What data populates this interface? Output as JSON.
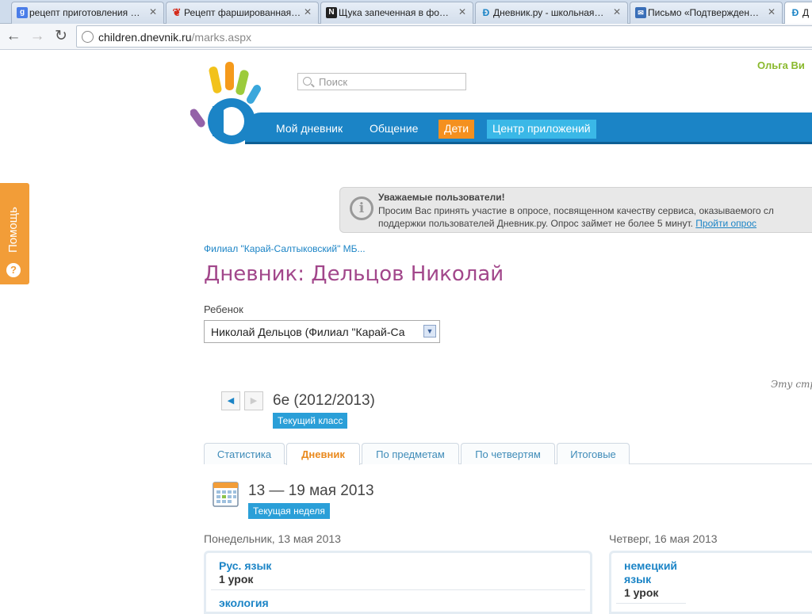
{
  "browser": {
    "tabs": [
      {
        "title": "рецепт приготовления …",
        "icon": "google-icon"
      },
      {
        "title": "Рецепт фаршированная…",
        "icon": "chili-icon"
      },
      {
        "title": "Щука запеченная в фо…",
        "icon": "n-logo-icon"
      },
      {
        "title": "Дневник.ру - школьная…",
        "icon": "dnevnik-icon"
      },
      {
        "title": "Письмо «Подтвержден…",
        "icon": "mail-icon"
      },
      {
        "title": "Д",
        "icon": "dnevnik-icon"
      }
    ],
    "url_host": "children.dnevnik.ru",
    "url_path": "/marks.aspx"
  },
  "help_label": "Помощь",
  "header": {
    "search_placeholder": "Поиск",
    "user_name": "Ольга Ви",
    "menu": [
      "Мой дневник",
      "Общение",
      "Дети",
      "Центр приложений"
    ]
  },
  "notice": {
    "title": "Уважаемые пользователи!",
    "line1": "Просим Вас принять участие в опросе, посвященном качеству сервиса, оказываемого сл",
    "line2": "поддержки пользователей Дневник.ру. Опрос займет не более 5 минут.",
    "link": "Пройти опрос"
  },
  "school": "Филиал \"Карай-Салтыковский\" МБ...",
  "page_title": "Дневник: Дельцов Николай",
  "child_label": "Ребенок",
  "child_select": "Николай Дельцов (Филиал \"Карай-Са",
  "side_note": "Эту стр",
  "class": {
    "name": "6е (2012/2013)",
    "badge": "Текущий класс"
  },
  "tabs": [
    "Статистика",
    "Дневник",
    "По предметам",
    "По четвертям",
    "Итоговые"
  ],
  "week": {
    "range": "13 — 19 мая 2013",
    "badge": "Текущая неделя"
  },
  "days": [
    {
      "title": "Понедельник, 13 мая 2013",
      "lessons": [
        {
          "subject": "Рус. язык",
          "number": "1 урок"
        },
        {
          "subject": "экология",
          "number": ""
        }
      ]
    },
    {
      "title": "Четверг, 16 мая 2013",
      "lessons": [
        {
          "subject": "немецкий язык",
          "number": "1 урок"
        }
      ]
    }
  ],
  "colors": {
    "brand_blue": "#1b84c6",
    "orange": "#f4901f",
    "title_purple": "#a2478b",
    "user_green": "#8ab92d"
  }
}
